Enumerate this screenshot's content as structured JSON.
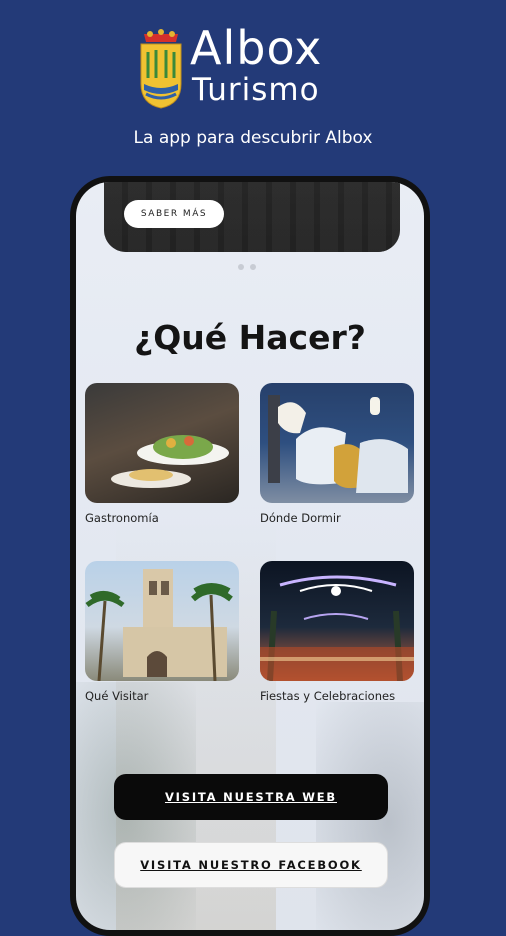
{
  "brand": {
    "title": "Albox",
    "subtitle": "Turismo",
    "tagline": "La app para descubrir Albox"
  },
  "hero": {
    "button_label": "SABER MÁS"
  },
  "section": {
    "heading": "¿Qué Hacer?"
  },
  "cards": [
    {
      "label": "Gastronomía",
      "icon": "food-image"
    },
    {
      "label": "Dónde Dormir",
      "icon": "bed-image"
    },
    {
      "label": "Qué Visitar",
      "icon": "church-image"
    },
    {
      "label": "Fiestas y Celebraciones",
      "icon": "festival-image"
    }
  ],
  "buttons": {
    "web": "VISITA NUESTRA WEB",
    "facebook": "VISITA NUESTRO FACEBOOK"
  },
  "colors": {
    "background": "#233a78",
    "dark_button": "#0a0a0a",
    "light_button": "#f7f7f7"
  }
}
